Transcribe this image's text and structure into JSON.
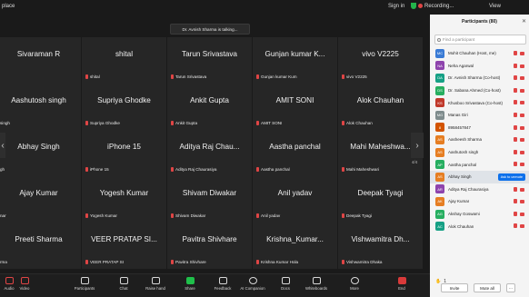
{
  "window": {
    "title": "place"
  },
  "topbar": {
    "signin": "Sign in",
    "recording": "Recording...",
    "view": "View"
  },
  "talking_banner": "Dr. Avnish Sharma is talking...",
  "grid": {
    "tiles": [
      {
        "name": "Sivaraman R",
        "tag": ""
      },
      {
        "name": "shital",
        "tag": "shital"
      },
      {
        "name": "Tarun Srivastava",
        "tag": "Tarun Srivastava"
      },
      {
        "name": "Gunjan kumar K...",
        "tag": "Gunjan kumar Kum"
      },
      {
        "name": "vivo V2225",
        "tag": "vivo V2225"
      },
      {
        "name": "Aashutosh singh",
        "tag": "singh"
      },
      {
        "name": "Supriya Ghodke",
        "tag": "Supriya Ghodke"
      },
      {
        "name": "Ankit Gupta",
        "tag": "Ankit Gupta"
      },
      {
        "name": "AMIT SONI",
        "tag": "AMIT SONI"
      },
      {
        "name": "Alok Chauhan",
        "tag": "Alok Chauhan"
      },
      {
        "name": "Abhay Singh",
        "tag": "gh"
      },
      {
        "name": "iPhone 15",
        "tag": "iPhone 15"
      },
      {
        "name": "Aditya Raj Chau...",
        "tag": "Aditya Raj Chaurasiya"
      },
      {
        "name": "Aastha panchal",
        "tag": "Aastha panchal"
      },
      {
        "name": "Mahi Maheshwa...",
        "tag": "Mahi Maheshwari"
      },
      {
        "name": "Ajay Kumar",
        "tag": "nar"
      },
      {
        "name": "Yogesh Kumar",
        "tag": "Yogesh Kumar"
      },
      {
        "name": "Shivam Diwakar",
        "tag": "Shivam Diwakar"
      },
      {
        "name": "Anil yadav",
        "tag": "Anil yadav"
      },
      {
        "name": "Deepak Tyagi",
        "tag": "Deepak Tyagi"
      },
      {
        "name": "Preeti Sharma",
        "tag": "rma"
      },
      {
        "name": "VEER PRATAP SI...",
        "tag": "VEER PRATAP SI"
      },
      {
        "name": "Pavitra Shivhare",
        "tag": "Pavitra Shivhare"
      },
      {
        "name": "Krishna_Kumar...",
        "tag": "Krishna Kumar Hola"
      },
      {
        "name": "Vishwamitra Dh...",
        "tag": "Vishwamitra Dhaka"
      }
    ],
    "page_indicator": "4/4"
  },
  "toolbar": {
    "items": [
      {
        "label": "Audio",
        "icon": "mic-icon"
      },
      {
        "label": "Video",
        "icon": "camera-icon"
      },
      {
        "label": "Participants",
        "icon": "people-icon"
      },
      {
        "label": "Chat",
        "icon": "chat-icon"
      },
      {
        "label": "Raise hand",
        "icon": "hand-icon"
      },
      {
        "label": "Share",
        "icon": "share-icon"
      },
      {
        "label": "Feedback",
        "icon": "feedback-icon"
      },
      {
        "label": "AI Companion",
        "icon": "ai-icon"
      },
      {
        "label": "Docs",
        "icon": "docs-icon"
      },
      {
        "label": "Whiteboards",
        "icon": "whiteboard-icon"
      },
      {
        "label": "More",
        "icon": "more-icon"
      },
      {
        "label": "End",
        "icon": "end-icon"
      }
    ]
  },
  "participants_panel": {
    "title": "Participants (80)",
    "search_placeholder": "Find a participant",
    "participants": [
      {
        "initials": "MC",
        "name": "Mohit Chauhan (Host, me)",
        "color": "#3a7bd5"
      },
      {
        "initials": "NA",
        "name": "Neha Agarwal",
        "color": "#8e44ad"
      },
      {
        "initials": "DA",
        "name": "Dr. Avnish Sharma (Co-host)",
        "color": "#16a085"
      },
      {
        "initials": "DS",
        "name": "Dr. Sabana Ahmed (Co-host)",
        "color": "#27ae60"
      },
      {
        "initials": "KS",
        "name": "Khusboo Srivastava (Co-host)",
        "color": "#c0392b"
      },
      {
        "initials": "MG",
        "name": "Manas Giri",
        "color": "#7f8c8d"
      },
      {
        "initials": "8",
        "name": "8958457847",
        "color": "#d35400"
      },
      {
        "initials": "AS",
        "name": "Aasheesh Sharma",
        "color": "#e67e22"
      },
      {
        "initials": "AS",
        "name": "Aashutosh singh",
        "color": "#e67e22"
      },
      {
        "initials": "AP",
        "name": "Aastha panchal",
        "color": "#27ae60"
      },
      {
        "initials": "AS",
        "name": "Abhay Singh",
        "color": "#e67e22",
        "highlight": true,
        "action": "Ask to unmute"
      },
      {
        "initials": "AR",
        "name": "Aditya Raj Chaurasiya",
        "color": "#8e44ad"
      },
      {
        "initials": "AK",
        "name": "Ajay Kumar",
        "color": "#e67e22"
      },
      {
        "initials": "AG",
        "name": "Akshay Goswami",
        "color": "#27ae60"
      },
      {
        "initials": "AC",
        "name": "Alok Chauhan",
        "color": "#16a085"
      }
    ],
    "hand_count": "1",
    "invite_label": "Invite",
    "mute_all_label": "Mute all",
    "more_label": "..."
  },
  "colors": {
    "accent": "#0e71eb",
    "mute_red": "#e04545",
    "share_green": "#1fbf4a"
  }
}
